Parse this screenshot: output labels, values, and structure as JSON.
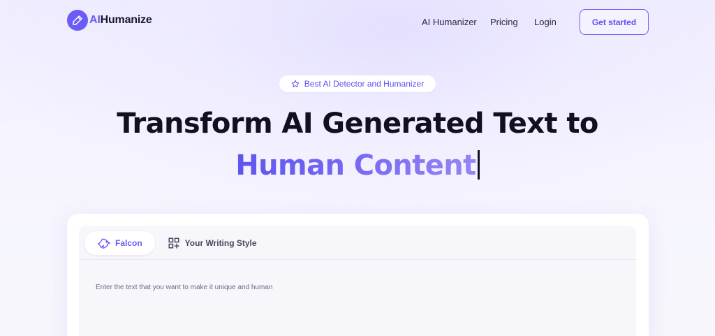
{
  "header": {
    "logo": {
      "ai": "AI",
      "rest": "Humanize"
    },
    "nav": [
      {
        "label": "AI Humanizer"
      },
      {
        "label": "Pricing"
      },
      {
        "label": "Login"
      }
    ],
    "cta_label": "Get started"
  },
  "hero": {
    "badge": "Best AI Detector and Humanizer",
    "title_line1": "Transform AI Generated Text to",
    "title_line2": "Human Content"
  },
  "editor": {
    "tabs": [
      {
        "label": "Falcon",
        "icon": "falcon-icon",
        "active": true
      },
      {
        "label": "Your Writing Style",
        "icon": "qr-plus-icon",
        "active": false
      }
    ],
    "placeholder": "Enter the text that you want to make it unique and human"
  },
  "colors": {
    "accent": "#6a5cf6",
    "heading": "#121020",
    "background": "#f3f1ff"
  }
}
